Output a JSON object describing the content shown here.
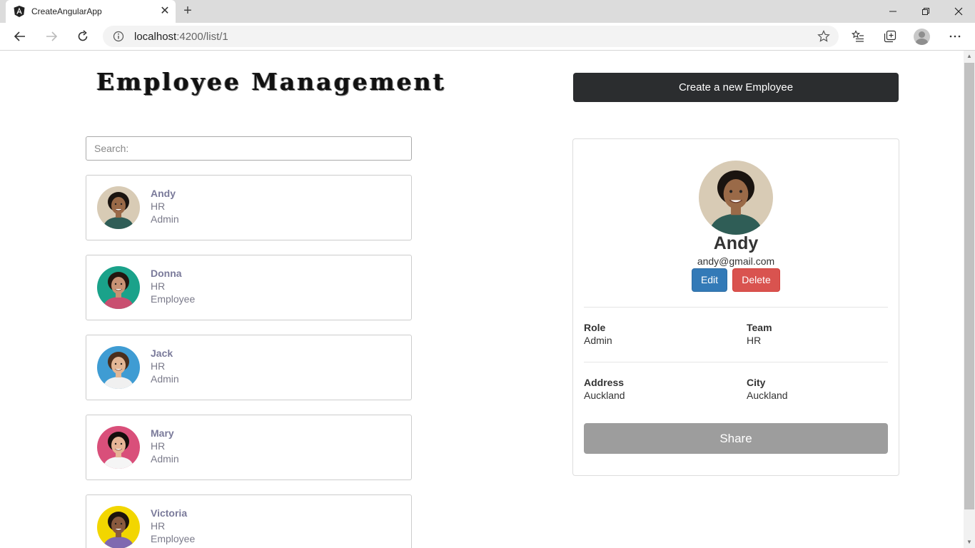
{
  "browser": {
    "tab_title": "CreateAngularApp",
    "close_tab_glyph": "✕",
    "new_tab_glyph": "+",
    "url_host": "localhost",
    "url_rest": ":4200/list/1",
    "favicon": "angular-icon"
  },
  "header": {
    "title": "Employee Management",
    "create_button": "Create a new Employee"
  },
  "search": {
    "placeholder": "Search:"
  },
  "employees": [
    {
      "name": "Andy",
      "team": "HR",
      "role": "Admin",
      "avatar_color": "#d8cbb5",
      "skin": "#9a6a48",
      "hair": "#1a1410",
      "shirt": "#2f5d56"
    },
    {
      "name": "Donna",
      "team": "HR",
      "role": "Employee",
      "avatar_color": "#1aa28a",
      "skin": "#c89274",
      "hair": "#24160f",
      "shirt": "#c94f70"
    },
    {
      "name": "Jack",
      "team": "HR",
      "role": "Admin",
      "avatar_color": "#3f9cd3",
      "skin": "#e2b695",
      "hair": "#4a2e1c",
      "shirt": "#f0f0f0"
    },
    {
      "name": "Mary",
      "team": "HR",
      "role": "Admin",
      "avatar_color": "#d94f7a",
      "skin": "#e5b496",
      "hair": "#140e0c",
      "shirt": "#f5f5f5"
    },
    {
      "name": "Victoria",
      "team": "HR",
      "role": "Employee",
      "avatar_color": "#f2d600",
      "skin": "#8a5a3e",
      "hair": "#1c130e",
      "shirt": "#7f69b0"
    }
  ],
  "detail": {
    "name": "Andy",
    "email": "andy@gmail.com",
    "edit_button": "Edit",
    "delete_button": "Delete",
    "role_label": "Role",
    "role_value": "Admin",
    "team_label": "Team",
    "team_value": "HR",
    "address_label": "Address",
    "address_value": "Auckland",
    "city_label": "City",
    "city_value": "Auckland",
    "share_button": "Share"
  }
}
